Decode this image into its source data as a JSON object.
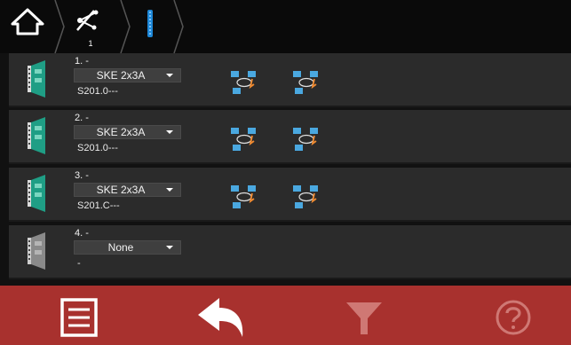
{
  "breadcrumb": {
    "home_icon": "home-icon",
    "connection_icon": "connection-icon",
    "connection_index": "1",
    "bus_icon": "bus-module-icon"
  },
  "modules": [
    {
      "slot": "1. -",
      "type": "SKE 2x3A",
      "address": "S201.0---",
      "active": true
    },
    {
      "slot": "2. -",
      "type": "SKE 2x3A",
      "address": "S201.0---",
      "active": true
    },
    {
      "slot": "3. -",
      "type": "SKE 2x3A",
      "address": "S201.C---",
      "active": true
    },
    {
      "slot": "4. -",
      "type": "None",
      "address": "-",
      "active": false
    }
  ],
  "toolbar": {
    "menu_icon": "menu-icon",
    "back_icon": "back-arrow-icon",
    "filter_icon": "filter-icon",
    "help_icon": "help-icon",
    "filter_enabled": false,
    "help_enabled": false
  },
  "colors": {
    "toolbar_bg": "#a8312e",
    "module_active": "#1f9e85",
    "module_inactive": "#8a8a8a",
    "port_blue": "#4aa8e0",
    "port_arrow": "#f08a30"
  }
}
